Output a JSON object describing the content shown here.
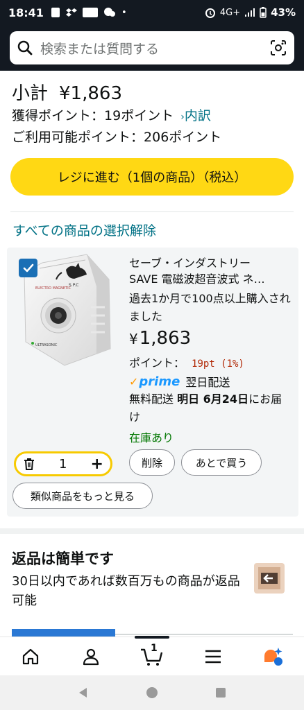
{
  "status_bar": {
    "time": "18:41",
    "network": "4G+",
    "battery": "43%"
  },
  "search": {
    "placeholder": "検索または質問する",
    "icon": "search-icon",
    "camera_icon": "camera-icon"
  },
  "summary": {
    "subtotal_label": "小計",
    "subtotal_value": "¥1,863",
    "points_label": "獲得ポイント：",
    "points_value": "19ポイント",
    "points_detail_link": "内訳",
    "available_label": "ご利用可能ポイント：",
    "available_value": "206ポイント"
  },
  "checkout_button": "レジに進む（1個の商品）（税込）",
  "deselect_all": "すべての商品の選択解除",
  "item": {
    "title_line1": "セーブ・インダストリー",
    "title_line2": "SAVE 電磁波超音波式 ネ…",
    "bought_info": "過去1か月で100点以上購入されました",
    "price_yen": "¥",
    "price": "1,863",
    "points_label": "ポイント：",
    "points_value": "19pt (1%)",
    "prime_label": "prime",
    "prime_delivery": "翌日配送",
    "free_shipping_prefix": "無料配送 ",
    "delivery_date": "明日 6月24日",
    "free_shipping_suffix": "にお届け",
    "stock": "在庫あり",
    "quantity": "1",
    "delete_button": "削除",
    "save_later_button": "あとで買う",
    "see_similar_button": "類似商品をもっと見る",
    "image_logo_text": "S.P.C",
    "image_label_top": "ELECTRO MAGNETIC",
    "image_label_bottom": "ULTRASONIC"
  },
  "returns": {
    "title": "返品は簡単です",
    "description": "30日以内であれば数百万もの商品が返品可能"
  },
  "bottom_nav": {
    "cart_count": "1",
    "items": [
      "home-icon",
      "account-icon",
      "cart-icon",
      "menu-icon",
      "rufus-icon"
    ]
  },
  "colors": {
    "header_bg": "#131921",
    "checkout_yellow": "#ffd814",
    "link_teal": "#007185",
    "price_red": "#b12704",
    "stock_green": "#007600",
    "prime_blue": "#1a98ff"
  }
}
